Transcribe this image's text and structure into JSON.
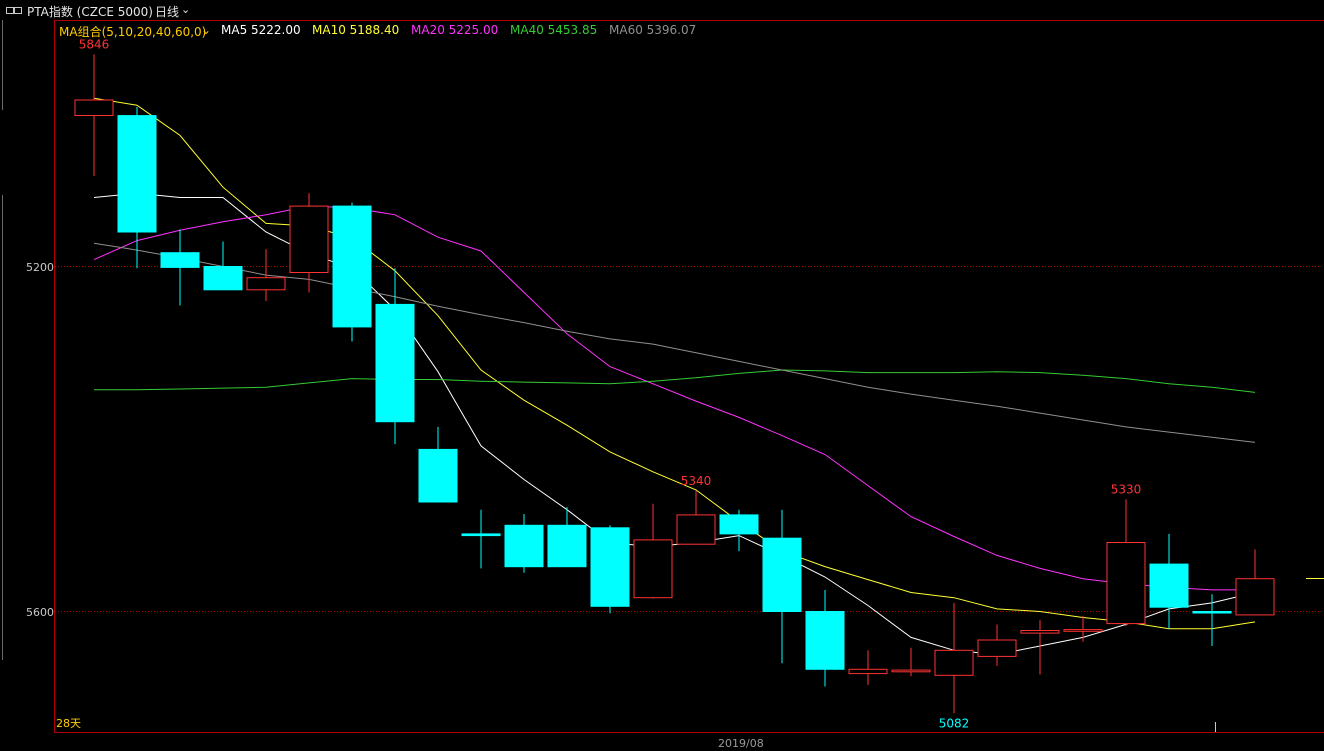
{
  "header": {
    "title": "PTA指数 (CZCE 5000)",
    "period": "日线",
    "period_arrow": "⌄"
  },
  "ma_legend": {
    "group_label": "MA组合(5,10,20,40,60,0)",
    "group_arrow": "⌄",
    "items": [
      {
        "text": "MA5 5222.00",
        "color": "#ffffff"
      },
      {
        "text": "MA10 5188.40",
        "color": "#ffff33"
      },
      {
        "text": "MA20 5225.00",
        "color": "#ff33ff"
      },
      {
        "text": "MA40 5453.85",
        "color": "#33cc33"
      },
      {
        "text": "MA60 5396.07",
        "color": "#8f8f8f"
      }
    ]
  },
  "colors": {
    "up": "#ff3333",
    "down": "#00ffff",
    "ma5": "#ffffff",
    "ma10": "#ffff33",
    "ma20": "#ff33ff",
    "ma40": "#33cc33",
    "ma60": "#8f8f8f",
    "gridline": "#b00000",
    "frame": "#b00000"
  },
  "chart_data": {
    "type": "candlestick",
    "title": "",
    "ylim": [
      5082,
      5846
    ],
    "y_ticks": [
      5200,
      5600
    ],
    "x_label_visible": "2019/08",
    "bottom_left_label": "28天",
    "annotations": [
      {
        "text": "5846",
        "index": 0,
        "kind": "high",
        "color": "#ff3333"
      },
      {
        "text": "5340",
        "index": 14,
        "kind": "high",
        "color": "#ff3333"
      },
      {
        "text": "5330",
        "index": 24,
        "kind": "high",
        "color": "#ff3333"
      },
      {
        "text": "5082",
        "index": 20,
        "kind": "low",
        "color": "#00ffff"
      }
    ],
    "candles": [
      {
        "o": 5775,
        "c": 5793,
        "h": 5846,
        "l": 5705
      },
      {
        "o": 5775,
        "c": 5640,
        "h": 5785,
        "l": 5598
      },
      {
        "o": 5616,
        "c": 5599,
        "h": 5643,
        "l": 5555
      },
      {
        "o": 5600,
        "c": 5573,
        "h": 5629,
        "l": 5575
      },
      {
        "o": 5573,
        "c": 5587,
        "h": 5620,
        "l": 5560
      },
      {
        "o": 5593,
        "c": 5670,
        "h": 5685,
        "l": 5570
      },
      {
        "o": 5670,
        "c": 5530,
        "h": 5674,
        "l": 5513
      },
      {
        "o": 5556,
        "c": 5420,
        "h": 5598,
        "l": 5394
      },
      {
        "o": 5388,
        "c": 5327,
        "h": 5414,
        "l": 5327
      },
      {
        "o": 5290,
        "c": 5288,
        "h": 5318,
        "l": 5250
      },
      {
        "o": 5300,
        "c": 5252,
        "h": 5313,
        "l": 5245
      },
      {
        "o": 5300,
        "c": 5252,
        "h": 5321,
        "l": 5252
      },
      {
        "o": 5297,
        "c": 5206,
        "h": 5300,
        "l": 5198
      },
      {
        "o": 5216,
        "c": 5283,
        "h": 5325,
        "l": 5215
      },
      {
        "o": 5278,
        "c": 5312,
        "h": 5340,
        "l": 5278
      },
      {
        "o": 5312,
        "c": 5290,
        "h": 5318,
        "l": 5270
      },
      {
        "o": 5285,
        "c": 5200,
        "h": 5318,
        "l": 5140
      },
      {
        "o": 5200,
        "c": 5133,
        "h": 5225,
        "l": 5113
      },
      {
        "o": 5128,
        "c": 5133,
        "h": 5155,
        "l": 5115
      },
      {
        "o": 5130,
        "c": 5132,
        "h": 5158,
        "l": 5125
      },
      {
        "o": 5126,
        "c": 5155,
        "h": 5210,
        "l": 5082
      },
      {
        "o": 5148,
        "c": 5167,
        "h": 5185,
        "l": 5137
      },
      {
        "o": 5175,
        "c": 5178,
        "h": 5190,
        "l": 5127
      },
      {
        "o": 5177,
        "c": 5179,
        "h": 5195,
        "l": 5165
      },
      {
        "o": 5186,
        "c": 5280,
        "h": 5330,
        "l": 5183
      },
      {
        "o": 5255,
        "c": 5205,
        "h": 5290,
        "l": 5180
      },
      {
        "o": 5200,
        "c": 5199,
        "h": 5220,
        "l": 5160
      },
      {
        "o": 5196,
        "c": 5238,
        "h": 5272,
        "l": 5196
      }
    ],
    "series": [
      {
        "name": "MA5",
        "values": [
          5680,
          5685,
          5680,
          5680,
          5640,
          5615,
          5598,
          5550,
          5478,
          5392,
          5353,
          5318,
          5280,
          5275,
          5280,
          5288,
          5265,
          5240,
          5207,
          5170,
          5155,
          5150,
          5160,
          5170,
          5185,
          5203,
          5210,
          5222
        ]
      },
      {
        "name": "MA10",
        "values": [
          5795,
          5787,
          5752,
          5692,
          5650,
          5647,
          5633,
          5595,
          5543,
          5480,
          5445,
          5416,
          5385,
          5362,
          5341,
          5304,
          5270,
          5252,
          5237,
          5222,
          5216,
          5203,
          5200,
          5193,
          5188,
          5180,
          5180,
          5188
        ]
      },
      {
        "name": "MA20",
        "values": [
          5608,
          5630,
          5642,
          5652,
          5660,
          5670,
          5668,
          5660,
          5634,
          5618,
          5570,
          5522,
          5484,
          5464,
          5444,
          5425,
          5404,
          5382,
          5346,
          5310,
          5287,
          5265,
          5250,
          5238,
          5232,
          5228,
          5225,
          5225
        ]
      },
      {
        "name": "MA40",
        "values": [
          5457,
          5457,
          5458,
          5459,
          5460,
          5465,
          5470,
          5469,
          5469,
          5467,
          5466,
          5465,
          5464,
          5467,
          5471,
          5476,
          5480,
          5479,
          5477,
          5477,
          5477,
          5478,
          5477,
          5474,
          5470,
          5464,
          5460,
          5454
        ]
      },
      {
        "name": "MA60",
        "values": [
          5627,
          5619,
          5610,
          5600,
          5590,
          5585,
          5575,
          5565,
          5554,
          5544,
          5535,
          5525,
          5516,
          5510,
          5500,
          5490,
          5480,
          5470,
          5460,
          5452,
          5445,
          5438,
          5430,
          5422,
          5414,
          5408,
          5402,
          5396
        ]
      }
    ]
  }
}
